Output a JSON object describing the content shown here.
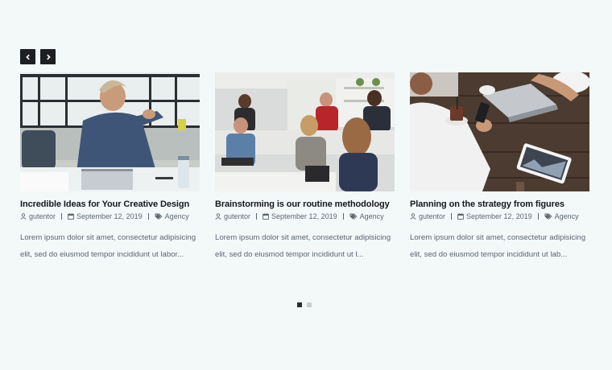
{
  "navigation": {
    "prev_icon": "chevron-left-icon",
    "next_icon": "chevron-right-icon"
  },
  "posts": [
    {
      "title": "Incredible Ideas for Your Creative Design",
      "author": "gutentor",
      "date": "September 12, 2019",
      "category": "Agency",
      "excerpt": "Lorem ipsum dolor sit amet, consectetur adipisicing elit, sed do eiusmod tempor incididunt ut labor..."
    },
    {
      "title": "Brainstorming is our routine methodology",
      "author": "gutentor",
      "date": "September 12, 2019",
      "category": "Agency",
      "excerpt": "Lorem ipsum dolor sit amet, consectetur adipisicing elit, sed do eiusmod tempor incididunt ut l..."
    },
    {
      "title": "Planning on the strategy from figures",
      "author": "gutentor",
      "date": "September 12, 2019",
      "category": "Agency",
      "excerpt": "Lorem ipsum dolor sit amet, consectetur adipisicing elit, sed do eiusmod tempor incididunt ut lab..."
    }
  ],
  "pagination": {
    "total_pages": 2,
    "active_page": 1
  },
  "colors": {
    "background": "#f3f8f9",
    "nav_button": "#1d1f22",
    "title": "#16181b",
    "meta": "#5d6872",
    "dot_active": "#2a2c2f",
    "dot_inactive": "#c9cdd1"
  }
}
